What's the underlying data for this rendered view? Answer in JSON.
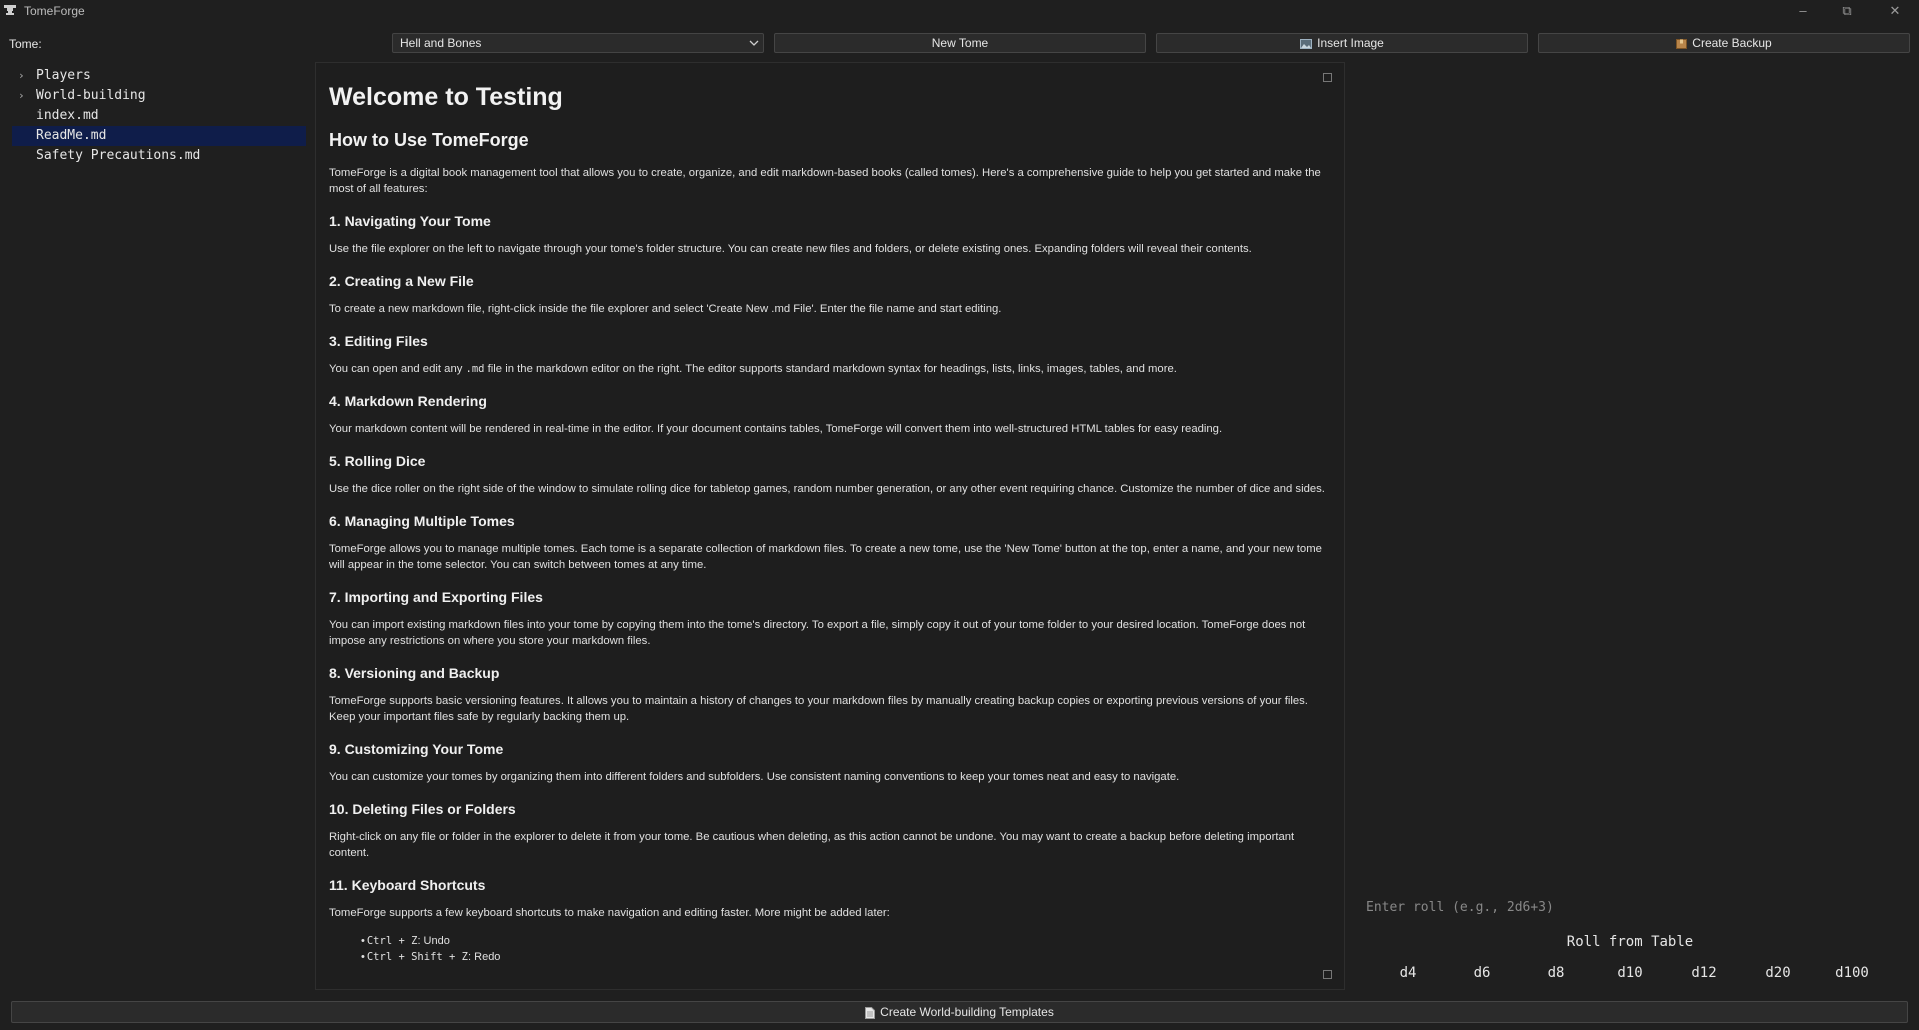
{
  "window": {
    "title": "TomeForge",
    "icon": "anvil-icon",
    "controls": [
      "minimize-icon",
      "restore-icon",
      "close-icon"
    ]
  },
  "toolbar": {
    "tome_label": "Tome:",
    "tome_selected": "Hell and Bones",
    "new_tome": "New Tome",
    "insert_image": "Insert Image",
    "create_backup": "Create Backup"
  },
  "file_tree": [
    {
      "label": "Players",
      "folder": true
    },
    {
      "label": "World-building",
      "folder": true
    },
    {
      "label": "index.md",
      "folder": false
    },
    {
      "label": "ReadMe.md",
      "folder": false,
      "selected": true
    },
    {
      "label": "Safety Precautions.md",
      "folder": false
    }
  ],
  "document": {
    "h1": "Welcome to Testing",
    "h2": "How to Use TomeForge",
    "intro": "TomeForge is a digital book management tool that allows you to create, organize, and edit markdown-based books (called tomes). Here's a comprehensive guide to help you get started and make the most of all features:",
    "sections": [
      {
        "heading": "1. Navigating Your Tome",
        "text": "Use the file explorer on the left to navigate through your tome's folder structure. You can create new files and folders, or delete existing ones. Expanding folders will reveal their contents."
      },
      {
        "heading": "2. Creating a New File",
        "text": "To create a new markdown file, right-click inside the file explorer and select 'Create New .md File'. Enter the file name and start editing."
      },
      {
        "heading": "3. Editing Files",
        "text_before": "You can open and edit any ",
        "code": ".md",
        "text_after": " file in the markdown editor on the right. The editor supports standard markdown syntax for headings, lists, links, images, tables, and more."
      },
      {
        "heading": "4. Markdown Rendering",
        "text": "Your markdown content will be rendered in real-time in the editor. If your document contains tables, TomeForge will convert them into well-structured HTML tables for easy reading."
      },
      {
        "heading": "5. Rolling Dice",
        "text": "Use the dice roller on the right side of the window to simulate rolling dice for tabletop games, random number generation, or any other event requiring chance. Customize the number of dice and sides."
      },
      {
        "heading": "6. Managing Multiple Tomes",
        "text": "TomeForge allows you to manage multiple tomes. Each tome is a separate collection of markdown files. To create a new tome, use the 'New Tome' button at the top, enter a name, and your new tome will appear in the tome selector. You can switch between tomes at any time."
      },
      {
        "heading": "7. Importing and Exporting Files",
        "text": "You can import existing markdown files into your tome by copying them into the tome's directory. To export a file, simply copy it out of your tome folder to your desired location. TomeForge does not impose any restrictions on where you store your markdown files."
      },
      {
        "heading": "8. Versioning and Backup",
        "text": "TomeForge supports basic versioning features. It allows you to maintain a history of changes to your markdown files by manually creating backup copies or exporting previous versions of your files. Keep your important files safe by regularly backing them up."
      },
      {
        "heading": "9. Customizing Your Tome",
        "text": "You can customize your tomes by organizing them into different folders and subfolders. Use consistent naming conventions to keep your tomes neat and easy to navigate."
      },
      {
        "heading": "10. Deleting Files or Folders",
        "text": "Right-click on any file or folder in the explorer to delete it from your tome. Be cautious when deleting, as this action cannot be undone. You may want to create a backup before deleting important content."
      },
      {
        "heading": "11. Keyboard Shortcuts",
        "text": "TomeForge supports a few keyboard shortcuts to make navigation and editing faster. More might be added later:"
      }
    ],
    "shortcuts": [
      {
        "keys": "Ctrl + Z",
        "action": ": Undo"
      },
      {
        "keys": "Ctrl + Shift + Z",
        "action": ": Redo"
      }
    ]
  },
  "dice": {
    "input_placeholder": "Enter roll (e.g., 2d6+3)",
    "roll_table": "Roll from Table",
    "buttons": [
      "d4",
      "d6",
      "d8",
      "d10",
      "d12",
      "d20",
      "d100"
    ]
  },
  "bottom": {
    "templates": "Create World-building Templates"
  },
  "colors": {
    "background": "#1f1f1f",
    "selection": "#0f1d4a",
    "button": "#2b2b2b"
  }
}
